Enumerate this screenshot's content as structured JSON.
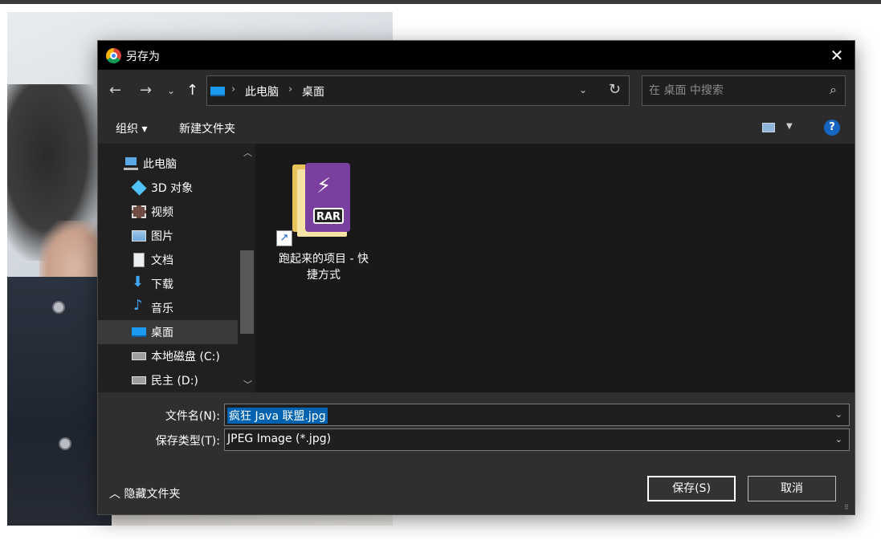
{
  "dialog": {
    "title": "另存为",
    "address": {
      "crumbs": [
        "此电脑",
        "桌面"
      ]
    },
    "search": {
      "placeholder": "在 桌面 中搜索"
    },
    "toolbar": {
      "organize": "组织 ▾",
      "new_folder": "新建文件夹",
      "help": "?"
    },
    "sidebar": {
      "items": [
        {
          "label": "此电脑",
          "icon": "computer-icon"
        },
        {
          "label": "3D 对象",
          "icon": "cube-icon"
        },
        {
          "label": "视频",
          "icon": "video-icon"
        },
        {
          "label": "图片",
          "icon": "picture-icon"
        },
        {
          "label": "文档",
          "icon": "document-icon"
        },
        {
          "label": "下载",
          "icon": "download-icon"
        },
        {
          "label": "音乐",
          "icon": "music-icon"
        },
        {
          "label": "桌面",
          "icon": "desktop-icon",
          "selected": true
        },
        {
          "label": "本地磁盘 (C:)",
          "icon": "drive-icon"
        },
        {
          "label": "民主 (D:)",
          "icon": "drive-icon"
        }
      ]
    },
    "files": [
      {
        "label": "跑起来的项目 - 快捷方式",
        "badge": "RAR"
      }
    ],
    "form": {
      "filename_label": "文件名(N):",
      "filename_value": "疯狂 Java 联盟.jpg",
      "filetype_label": "保存类型(T):",
      "filetype_value": "JPEG Image (*.jpg)"
    },
    "hide_folders": "隐藏文件夹",
    "buttons": {
      "save": "保存(S)",
      "cancel": "取消"
    }
  },
  "colors": {
    "titlebar": "#000000",
    "accent": "#0063b1",
    "selected_item": "#3a3a3a",
    "help_blue": "#1565c0"
  }
}
